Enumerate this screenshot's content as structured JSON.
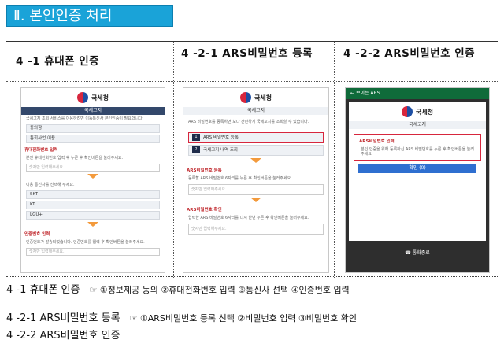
{
  "title": "Ⅱ. 본인인증 처리",
  "headers": [
    "4 -1 휴대폰 인증",
    "4 -2-1 ARS비밀번호 등록",
    "4 -2-2 ARS비밀번호 인증"
  ],
  "shot1": {
    "brand": "국세청",
    "nav": "국세고지",
    "intro": "국세고지 조회 서비스를 이용하려면 이동통신사 본인인증이 필요합니다.",
    "terms": [
      "동의함",
      "통회사업 이용"
    ],
    "step2": "휴대전화번호 입력",
    "step2_desc": "본인 휴대전화번호 입력 후 누른 후 확인버튼을 눌러주세요.",
    "phone_ph": "숫자만 입력해주세요.",
    "carrier_label": "이용 통신사를 선택해 주세요.",
    "carriers": [
      "SKT",
      "KT",
      "LGU+"
    ],
    "step4": "인증번호 입력",
    "step4_desc": "인증번호가 발송되었습니다. 인증번호를 입력 후 확인버튼을 눌러주세요.",
    "code_ph": "숫자만 입력해주세요."
  },
  "shot2": {
    "brand": "국세청",
    "nav": "국세고지",
    "intro": "ARS 비밀번호를 등록하면 보다 간편하게 국세고지를 조회할 수 있습니다.",
    "options": [
      "ARS 비밀번호 등록",
      "국세고지 내역 조회"
    ],
    "step2": "ARS비밀번호 등록",
    "step2_desc": "등록할 ARS 비밀번호 6자리를 누른 후 확인버튼을 눌러주세요.",
    "pw_ph": "숫자만 입력해주세요.",
    "step3": "ARS비밀번호 확인",
    "step3_desc": "입력한 ARS 비밀번호 6자리를 다시 한번 누른 후 확인버튼을 눌러주세요.",
    "pw2_ph": "숫자만 입력해주세요."
  },
  "shot3": {
    "back": "보이는 ARS",
    "brand": "국세청",
    "nav": "국세고지",
    "step": "ARS비밀번호 입력",
    "step_desc": "본인 인증을 위해 등록하신 ARS 비밀번호를 누른 후 확인버튼을 눌러주세요.",
    "confirm": "확인 (0)",
    "bottom": "통화종료"
  },
  "footer": {
    "line1": "4 -1 휴대폰 인증",
    "line1_note": "☞ ①정보제공 동의 ②휴대전화번호 입력 ③통신사 선택 ④인증번호 입력",
    "line2": "4 -2-1 ARS비밀번호 등록",
    "line2_note": "☞ ①ARS비밀번호 등록 선택 ②비밀번호 입력 ③비밀번호 확인",
    "line3": "4 -2-2 ARS비밀번호 인증"
  }
}
